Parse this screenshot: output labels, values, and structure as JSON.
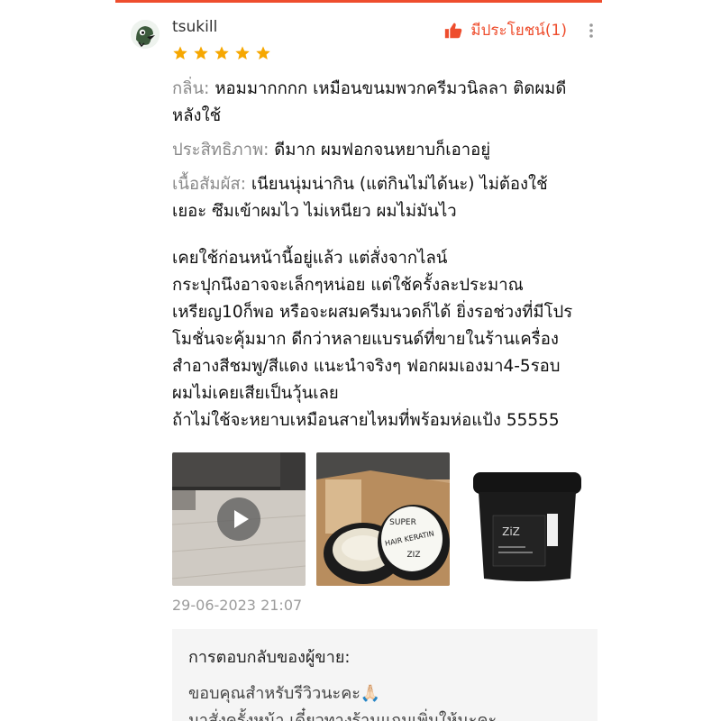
{
  "review": {
    "username": "tsukill",
    "helpful_label": "มีประโยชน์(1)",
    "rating": 5,
    "star_color": "#f6a700",
    "accent_color": "#ee4d2d",
    "attributes": [
      {
        "label": "กลิ่น:",
        "value_lines": [
          "หอมมากกกก เหมือนขนมพวกครีมวนิลลา ติดผมดี",
          "หลังใช้"
        ]
      },
      {
        "label": "ประสิทธิภาพ:",
        "value_lines": [
          "ดีมาก ผมฟอกจนหยาบก็เอาอยู่"
        ]
      },
      {
        "label": "เนื้อสัมผัส:",
        "value_lines": [
          "เนียนนุ่มน่ากิน (แต่กินไม่ได้นะ) ไม่ต้องใช้",
          "เยอะ ซึมเข้าผมไว ไม่เหนียว ผมไม่มันไว"
        ]
      }
    ],
    "paragraph_lines": [
      "เคยใช้ก่อนหน้านี้อยู่แล้ว แต่สั่งจากไลน์",
      "กระปุกนึงอาจจะเล็กๆหน่อย แต่ใช้ครั้งละประมาณ",
      "เหรียญ10ก็พอ หรือจะผสมครีมนวดก็ได้ ยิ่งรอช่วงที่มีโปร",
      "โมชั่นจะคุ้มมาก ดีกว่าหลายแบรนด์ที่ขายในร้านเครื่อง",
      "สำอางสีชมพู/สีแดง แนะนำจริงๆ ฟอกผมเองมา4-5รอบ",
      "ผมไม่เคยเสียเป็นวุ้นเลย",
      "ถ้าไม่ใช้จะหยาบเหมือนสายไหมที่พร้อมห่อแป้ง 55555"
    ],
    "media_labels": {
      "lid_text_1": "SUPER",
      "lid_text_2": "HAIR KERATIN",
      "lid_text_3": "ZIZ",
      "jar_brand": "ZiZ"
    },
    "date": "29-06-2023 21:07",
    "seller_reply": {
      "title": "การตอบกลับของผู้ขาย:",
      "lines": [
        "ขอบคุณสำหรับรีวิวนะคะ🙏🏻",
        "มาสั่งครั้งหน้า เดี๋ยวทางร้านแถมเพิ่มให้นะคะ"
      ]
    }
  }
}
